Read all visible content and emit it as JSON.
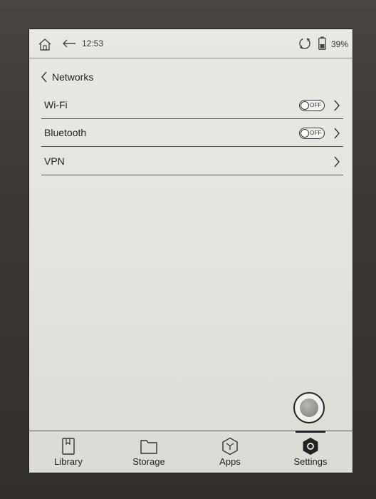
{
  "status_bar": {
    "home_icon": "home-icon",
    "back_icon": "arrow-left-icon",
    "time": "12:53",
    "sync_icon": "sync-icon",
    "battery_icon": "battery-icon",
    "battery_percent": "39%"
  },
  "page": {
    "back_icon": "chevron-left-icon",
    "title": "Networks"
  },
  "settings_rows": [
    {
      "label": "Wi-Fi",
      "toggle": "OFF",
      "chevron_icon": "chevron-right-icon"
    },
    {
      "label": "Bluetooth",
      "toggle": "OFF",
      "chevron_icon": "chevron-right-icon"
    },
    {
      "label": "VPN",
      "chevron_icon": "chevron-right-icon"
    }
  ],
  "floating_button": {
    "icon": "circle-button-icon"
  },
  "bottom_nav": {
    "items": [
      {
        "label": "Library",
        "icon": "book-icon"
      },
      {
        "label": "Storage",
        "icon": "folder-icon"
      },
      {
        "label": "Apps",
        "icon": "apps-cube-icon"
      },
      {
        "label": "Settings",
        "icon": "settings-icon",
        "active": true
      }
    ]
  },
  "colors": {
    "screen_bg": "#e6e6e0",
    "ink": "#222222",
    "bezel": "#3b3735"
  }
}
